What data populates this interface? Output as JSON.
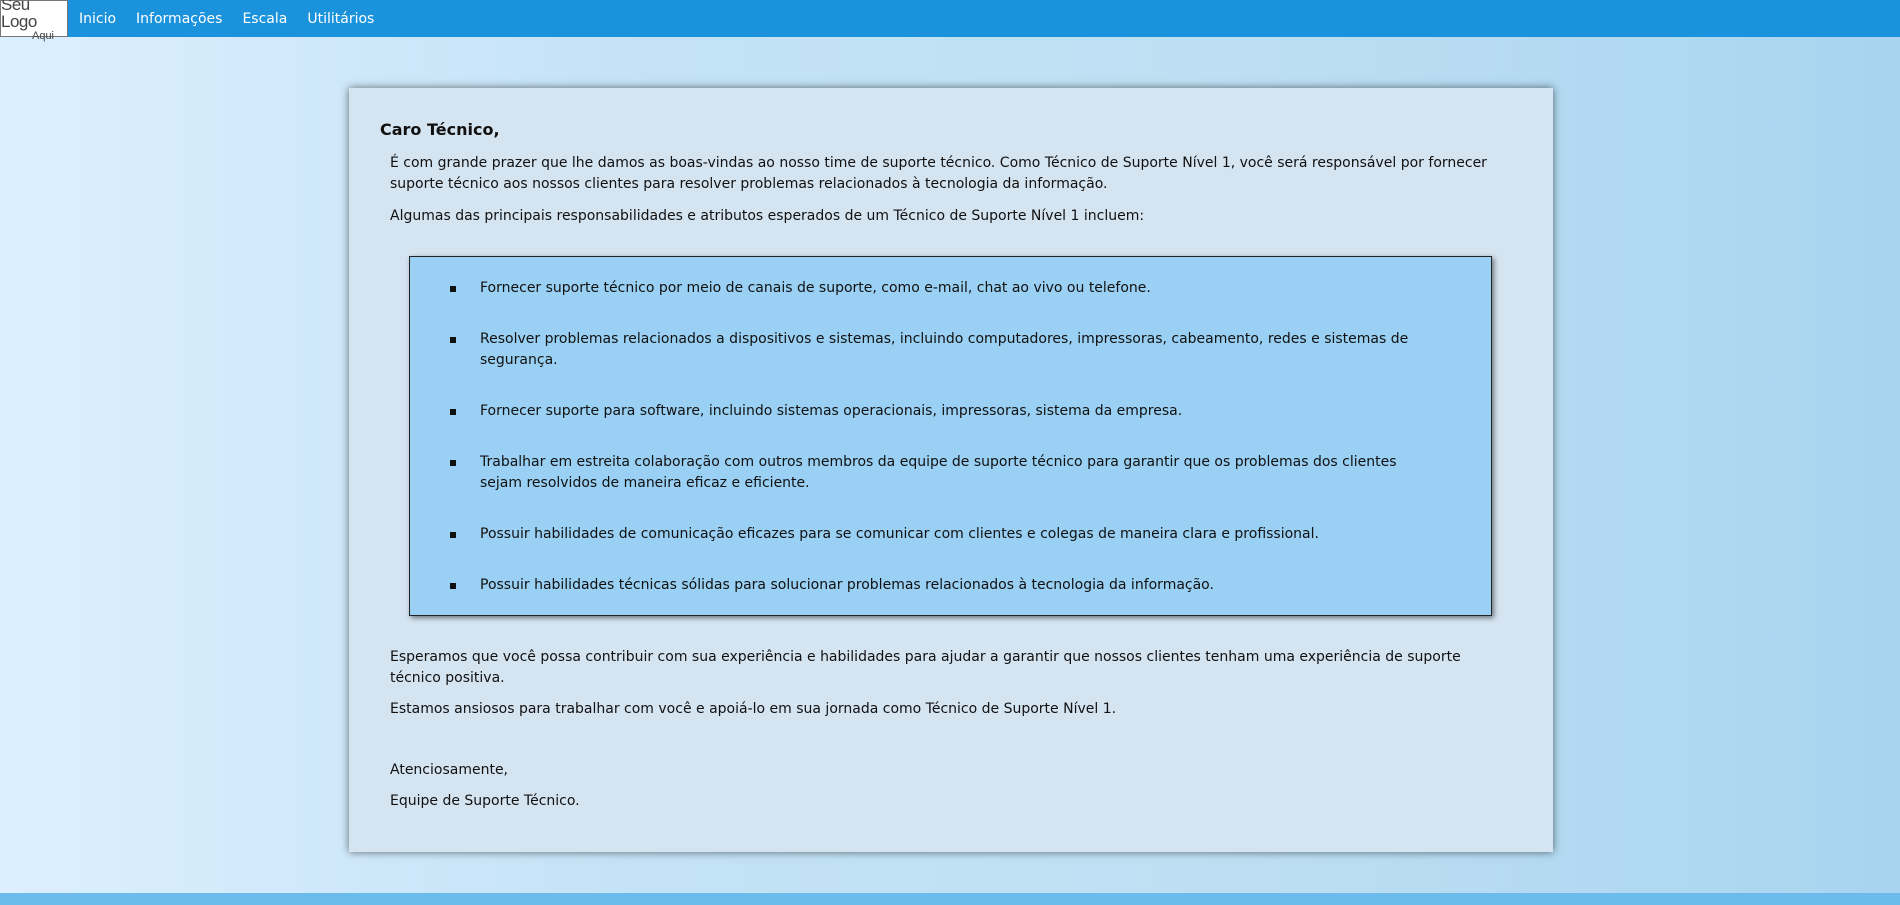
{
  "navbar": {
    "logo_line1": "Seu Logo",
    "logo_line2": "Aqui",
    "items": [
      "Inicio",
      "Informações",
      "Escala",
      "Utilitários"
    ]
  },
  "letter": {
    "greeting": "Caro Técnico,",
    "intro": "É com grande prazer que lhe damos as boas-vindas ao nosso time de suporte técnico. Como Técnico de Suporte Nível 1, você será responsável por fornecer suporte técnico aos nossos clientes para resolver problemas relacionados à tecnologia da informação.",
    "responsibilities_intro": "Algumas das principais responsabilidades e atributos esperados de um Técnico de Suporte Nível 1 incluem:",
    "responsibilities": [
      "Fornecer suporte técnico por meio de canais de suporte, como e-mail, chat ao vivo ou telefone.",
      "Resolver problemas relacionados a dispositivos e sistemas, incluindo computadores, impressoras, cabeamento, redes e sistemas de segurança.",
      "Fornecer suporte para software, incluindo sistemas operacionais, impressoras, sistema da empresa.",
      "Trabalhar em estreita colaboração com outros membros da equipe de suporte técnico para garantir que os problemas dos clientes sejam resolvidos de maneira eficaz e eficiente.",
      "Possuir habilidades de comunicação eficazes para se comunicar com clientes e colegas de maneira clara e profissional.",
      "Possuir habilidades técnicas sólidas para solucionar problemas relacionados à tecnologia da informação."
    ],
    "closing_hope": "Esperamos que você possa contribuir com sua experiência e habilidades para ajudar a garantir que nossos clientes tenham uma experiência de suporte técnico positiva.",
    "closing_anxious": "Estamos ansiosos para trabalhar com você e apoiá-lo em sua jornada como Técnico de Suporte Nível 1.",
    "signoff": "Atenciosamente,",
    "signature": "Equipe de Suporte Técnico."
  },
  "colors": {
    "navbar": "#1a92dc",
    "card": "#d5e4f1",
    "responsibilities_box": "#99d0f3",
    "bottom_bar": "#6bbbec"
  }
}
